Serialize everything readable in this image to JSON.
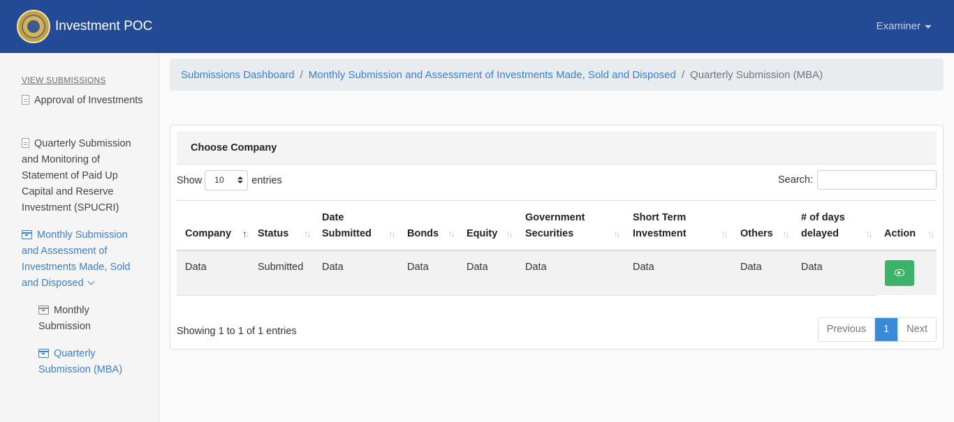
{
  "navbar": {
    "title": "Investment POC",
    "user": "Examiner"
  },
  "sidebar": {
    "heading": "VIEW SUBMISSIONS",
    "items": [
      {
        "label": "Approval of Investments"
      },
      {
        "label": "Quarterly Submission and Monitoring of Statement of Paid Up Capital and Reserve Investment (SPUCRI)"
      },
      {
        "label": "Monthly Submission and Assessment of Investments Made, Sold and Disposed"
      }
    ],
    "subitems": [
      {
        "label": "Monthly Submission"
      },
      {
        "label": "Quarterly Submission (MBA)"
      }
    ]
  },
  "breadcrumb": {
    "dashboard": "Submissions Dashboard",
    "monthly": "Monthly Submission and Assessment of Investments Made, Sold and Disposed",
    "current": "Quarterly Submission (MBA)",
    "separator": "/"
  },
  "card": {
    "title": "Choose Company",
    "show_label": "Show",
    "entries_value": "10",
    "entries_label": "entries",
    "search_label": "Search:",
    "search_value": ""
  },
  "table": {
    "columns": [
      "Company",
      "Status",
      "Date Submitted",
      "Bonds",
      "Equity",
      "Government Securities",
      "Short Term Investment",
      "Others",
      "# of days delayed",
      "Action"
    ],
    "rows": [
      [
        "Data",
        "Submitted",
        "Data",
        "Data",
        "Data",
        "Data",
        "Data",
        "Data",
        "Data"
      ]
    ],
    "sort_column": "Company",
    "sort_direction": "ascending"
  },
  "footer": {
    "showing": "Showing 1 to 1 of 1 entries",
    "previous": "Previous",
    "page": "1",
    "next": "Next"
  },
  "colors": {
    "navbar": "#234a95",
    "link": "#3a7fd0",
    "action": "#3bb46a",
    "page_active": "#3a8ad9"
  },
  "icons": {
    "sidebar_items": [
      "document-icon",
      "document-icon",
      "archive-box-icon"
    ],
    "action": "eye-icon"
  }
}
